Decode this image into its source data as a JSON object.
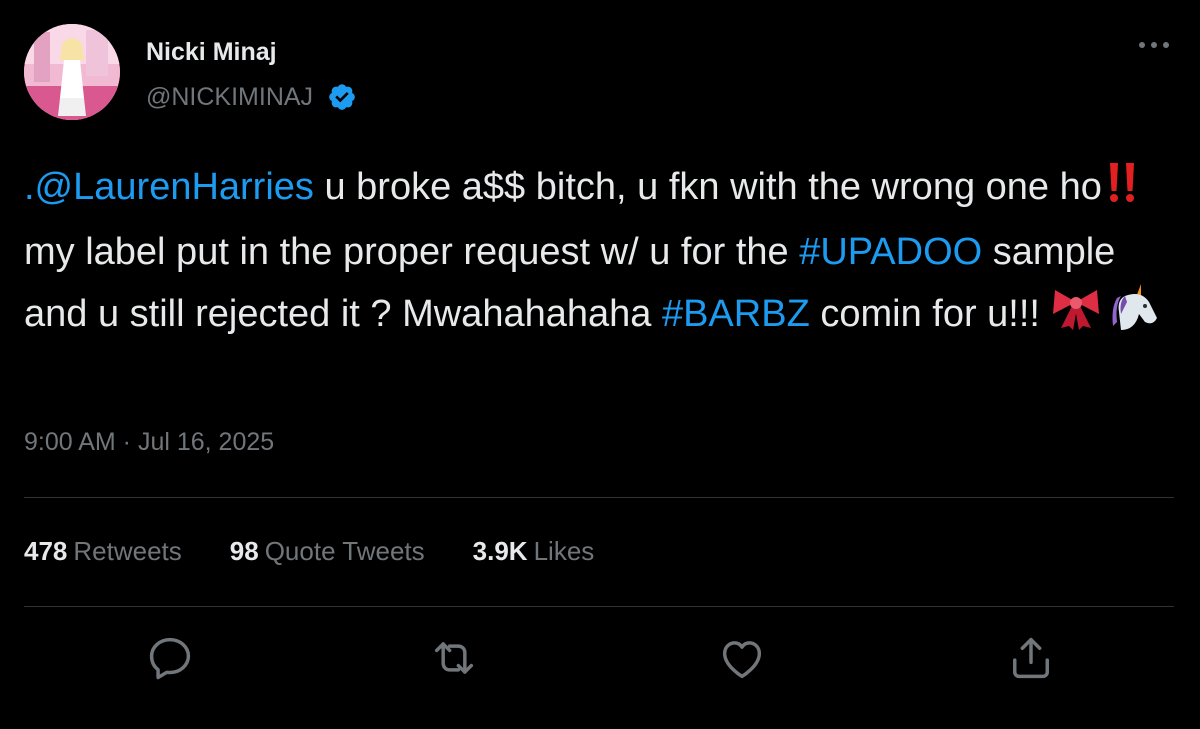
{
  "user": {
    "display_name": "Nicki Minaj",
    "handle": "@NICKIMINAJ",
    "verified": true
  },
  "tweet": {
    "mention": ".@LaurenHarries",
    "text_1": " u broke a$$ bitch, u fkn with the wrong one ho",
    "emoji_double_exclamation": "‼️",
    "text_2": " my label put in the proper request w/ u for the ",
    "hashtag_1": "#UPADOO",
    "text_3": " sample and u still rejected it ? Mwahahahaha ",
    "hashtag_2": "#BARBZ",
    "text_4": " comin for u!!! ",
    "emoji_ribbon": "ribbon-icon",
    "emoji_unicorn": "unicorn-icon",
    "timestamp": "9:00 AM · Jul 16, 2025"
  },
  "stats": {
    "retweets_count": "478",
    "retweets_label": "Retweets",
    "quotes_count": "98",
    "quotes_label": "Quote Tweets",
    "likes_count": "3.9K",
    "likes_label": "Likes"
  },
  "icons": {
    "more": "more-icon",
    "reply": "reply-icon",
    "retweet": "retweet-icon",
    "like": "heart-icon",
    "share": "share-icon"
  },
  "colors": {
    "background": "#000000",
    "text": "#e7e9ea",
    "muted": "#71767b",
    "link": "#1d9bf0",
    "divider": "#2f3336",
    "verified": "#1d9bf0"
  }
}
